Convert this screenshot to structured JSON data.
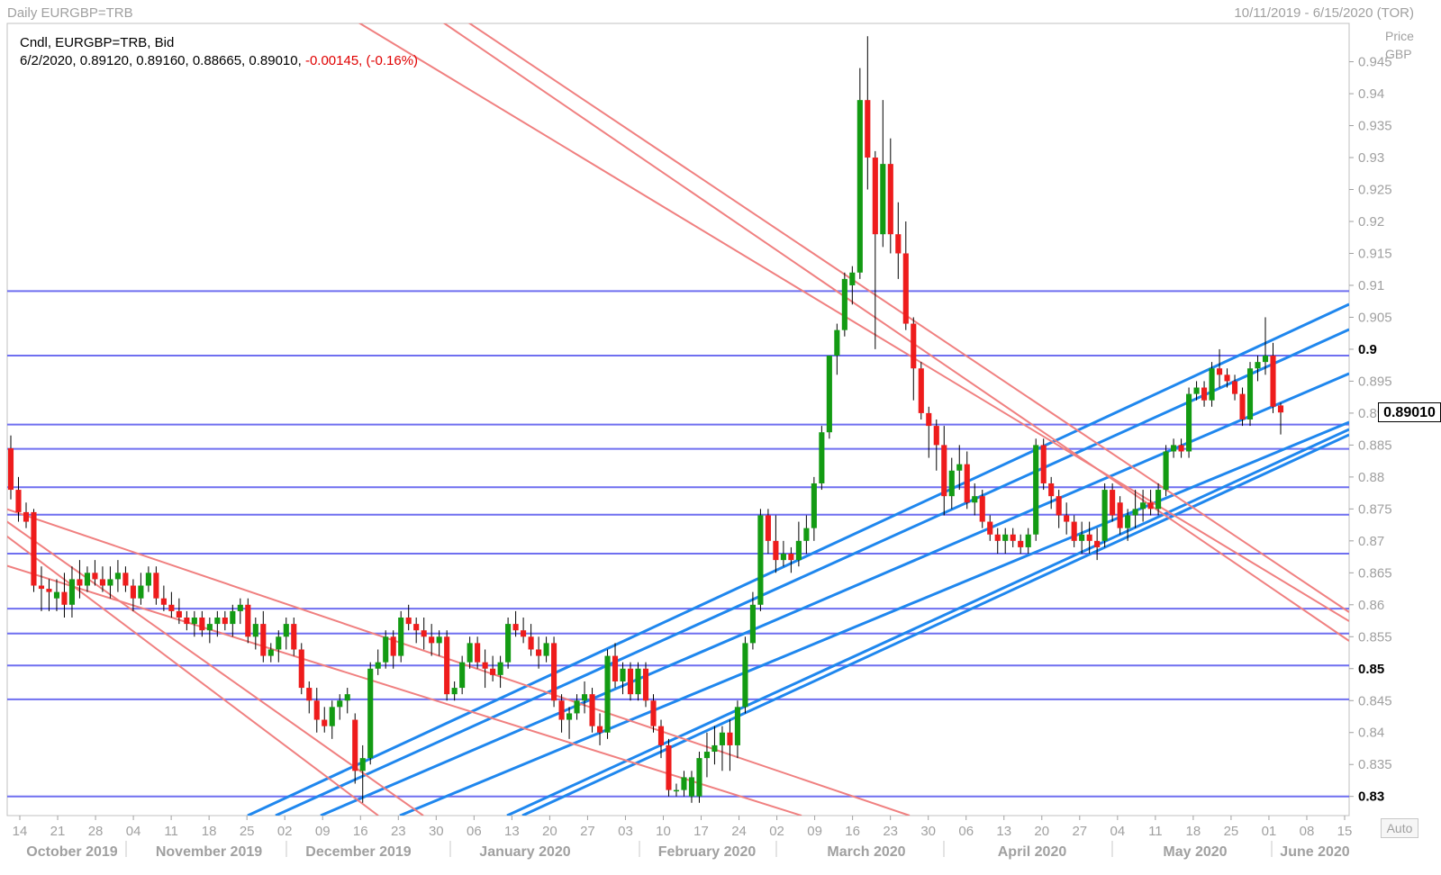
{
  "header": {
    "chart_title": "Daily EURGBP=TRB",
    "date_range": "10/11/2019 - 6/15/2020 (TOR)"
  },
  "legend": {
    "line1": "Cndl, EURGBP=TRB, Bid",
    "values": "6/2/2020, 0.89120, 0.89160, 0.88665, 0.89010,",
    "change": "-0.00145, (-0.16%)"
  },
  "price_axis": {
    "title_line1": "Price",
    "title_line2": "GBP",
    "auto_label": "Auto",
    "last_price": "0.89010"
  },
  "colors": {
    "up_candle": "#139b13",
    "down_candle": "#ee1c1c",
    "horizontal_line": "#6f6ff0",
    "channel_up": "#1f87ee",
    "channel_down": "#f08080",
    "grid_tick": "#a0a0a0"
  },
  "chart_data": {
    "type": "candlestick",
    "ylim": [
      0.827,
      0.951
    ],
    "y_ticks": [
      0.83,
      0.835,
      0.84,
      0.845,
      0.85,
      0.855,
      0.86,
      0.865,
      0.87,
      0.875,
      0.88,
      0.885,
      0.89,
      0.895,
      0.9,
      0.905,
      0.91,
      0.915,
      0.92,
      0.925,
      0.93,
      0.935,
      0.94,
      0.945
    ],
    "y_tick_labels": [
      "0.83",
      "0.835",
      "0.84",
      "0.845",
      "0.85",
      "0.855",
      "0.86",
      "0.865",
      "0.87",
      "0.875",
      "0.88",
      "0.885",
      "0.89",
      "0.895",
      "0.9",
      "0.905",
      "0.91",
      "0.915",
      "0.92",
      "0.925",
      "0.93",
      "0.935",
      "0.94",
      "0.945"
    ],
    "y_tick_bold": [
      "0.83",
      "0.85",
      "0.9"
    ],
    "x_day_labels": [
      "14",
      "21",
      "28",
      "04",
      "11",
      "18",
      "25",
      "02",
      "09",
      "16",
      "23",
      "30",
      "06",
      "13",
      "20",
      "27",
      "03",
      "10",
      "17",
      "24",
      "02",
      "09",
      "16",
      "23",
      "30",
      "06",
      "13",
      "20",
      "27",
      "04",
      "11",
      "18",
      "25",
      "01",
      "08",
      "15"
    ],
    "x_month_labels": [
      "October 2019",
      "November 2019",
      "December 2019",
      "January 2020",
      "February 2020",
      "March 2020",
      "April 2020",
      "May 2020",
      "June 2020"
    ],
    "horizontal_levels": [
      0.9091,
      0.899,
      0.8882,
      0.8844,
      0.8784,
      0.8741,
      0.868,
      0.8594,
      0.8555,
      0.8505,
      0.8452,
      0.83
    ],
    "candles": [
      [
        0.8845,
        0.8865,
        0.8765,
        0.878
      ],
      [
        0.878,
        0.88,
        0.873,
        0.8745
      ],
      [
        0.8745,
        0.876,
        0.872,
        0.873
      ],
      [
        0.8745,
        0.875,
        0.862,
        0.863
      ],
      [
        0.863,
        0.866,
        0.859,
        0.8625
      ],
      [
        0.8625,
        0.864,
        0.859,
        0.862
      ],
      [
        0.861,
        0.864,
        0.859,
        0.862
      ],
      [
        0.862,
        0.865,
        0.858,
        0.86
      ],
      [
        0.86,
        0.866,
        0.858,
        0.864
      ],
      [
        0.864,
        0.867,
        0.861,
        0.863
      ],
      [
        0.863,
        0.866,
        0.862,
        0.865
      ],
      [
        0.865,
        0.867,
        0.863,
        0.864
      ],
      [
        0.864,
        0.866,
        0.862,
        0.863
      ],
      [
        0.863,
        0.866,
        0.861,
        0.864
      ],
      [
        0.864,
        0.867,
        0.862,
        0.865
      ],
      [
        0.865,
        0.866,
        0.862,
        0.863
      ],
      [
        0.863,
        0.864,
        0.859,
        0.861
      ],
      [
        0.861,
        0.865,
        0.86,
        0.863
      ],
      [
        0.863,
        0.866,
        0.862,
        0.865
      ],
      [
        0.865,
        0.866,
        0.86,
        0.861
      ],
      [
        0.861,
        0.863,
        0.859,
        0.86
      ],
      [
        0.86,
        0.862,
        0.858,
        0.859
      ],
      [
        0.859,
        0.861,
        0.857,
        0.858
      ],
      [
        0.858,
        0.859,
        0.856,
        0.857
      ],
      [
        0.857,
        0.859,
        0.855,
        0.858
      ],
      [
        0.858,
        0.859,
        0.855,
        0.856
      ],
      [
        0.856,
        0.858,
        0.854,
        0.857
      ],
      [
        0.857,
        0.859,
        0.855,
        0.858
      ],
      [
        0.858,
        0.859,
        0.856,
        0.857
      ],
      [
        0.857,
        0.86,
        0.855,
        0.859
      ],
      [
        0.859,
        0.861,
        0.857,
        0.86
      ],
      [
        0.86,
        0.861,
        0.854,
        0.855
      ],
      [
        0.855,
        0.858,
        0.853,
        0.857
      ],
      [
        0.857,
        0.859,
        0.851,
        0.852
      ],
      [
        0.852,
        0.854,
        0.851,
        0.853
      ],
      [
        0.853,
        0.856,
        0.851,
        0.855
      ],
      [
        0.855,
        0.858,
        0.853,
        0.857
      ],
      [
        0.857,
        0.858,
        0.852,
        0.853
      ],
      [
        0.853,
        0.854,
        0.846,
        0.847
      ],
      [
        0.847,
        0.848,
        0.843,
        0.845
      ],
      [
        0.845,
        0.847,
        0.84,
        0.842
      ],
      [
        0.842,
        0.844,
        0.84,
        0.841
      ],
      [
        0.841,
        0.845,
        0.839,
        0.844
      ],
      [
        0.844,
        0.846,
        0.842,
        0.845
      ],
      [
        0.845,
        0.847,
        0.843,
        0.846
      ],
      [
        0.842,
        0.843,
        0.832,
        0.834
      ],
      [
        0.834,
        0.838,
        0.829,
        0.836
      ],
      [
        0.836,
        0.851,
        0.835,
        0.85
      ],
      [
        0.85,
        0.853,
        0.849,
        0.851
      ],
      [
        0.851,
        0.856,
        0.85,
        0.855
      ],
      [
        0.855,
        0.856,
        0.85,
        0.852
      ],
      [
        0.852,
        0.859,
        0.851,
        0.858
      ],
      [
        0.858,
        0.86,
        0.856,
        0.857
      ],
      [
        0.857,
        0.858,
        0.854,
        0.856
      ],
      [
        0.856,
        0.858,
        0.853,
        0.855
      ],
      [
        0.855,
        0.857,
        0.852,
        0.854
      ],
      [
        0.854,
        0.856,
        0.852,
        0.855
      ],
      [
        0.855,
        0.856,
        0.845,
        0.846
      ],
      [
        0.846,
        0.848,
        0.845,
        0.847
      ],
      [
        0.847,
        0.852,
        0.846,
        0.851
      ],
      [
        0.851,
        0.855,
        0.85,
        0.854
      ],
      [
        0.854,
        0.855,
        0.85,
        0.851
      ],
      [
        0.851,
        0.853,
        0.847,
        0.85
      ],
      [
        0.85,
        0.852,
        0.848,
        0.849
      ],
      [
        0.849,
        0.852,
        0.847,
        0.851
      ],
      [
        0.851,
        0.858,
        0.85,
        0.857
      ],
      [
        0.857,
        0.859,
        0.855,
        0.856
      ],
      [
        0.856,
        0.858,
        0.854,
        0.855
      ],
      [
        0.855,
        0.857,
        0.852,
        0.853
      ],
      [
        0.853,
        0.855,
        0.85,
        0.852
      ],
      [
        0.852,
        0.855,
        0.851,
        0.854
      ],
      [
        0.854,
        0.855,
        0.844,
        0.845
      ],
      [
        0.845,
        0.846,
        0.84,
        0.842
      ],
      [
        0.842,
        0.844,
        0.839,
        0.843
      ],
      [
        0.843,
        0.846,
        0.842,
        0.845
      ],
      [
        0.845,
        0.848,
        0.843,
        0.846
      ],
      [
        0.846,
        0.847,
        0.84,
        0.841
      ],
      [
        0.841,
        0.843,
        0.838,
        0.84
      ],
      [
        0.84,
        0.853,
        0.839,
        0.852
      ],
      [
        0.852,
        0.854,
        0.847,
        0.848
      ],
      [
        0.848,
        0.851,
        0.846,
        0.85
      ],
      [
        0.85,
        0.851,
        0.845,
        0.846
      ],
      [
        0.846,
        0.851,
        0.845,
        0.85
      ],
      [
        0.85,
        0.851,
        0.844,
        0.845
      ],
      [
        0.845,
        0.846,
        0.84,
        0.841
      ],
      [
        0.841,
        0.842,
        0.836,
        0.838
      ],
      [
        0.838,
        0.839,
        0.83,
        0.831
      ],
      [
        0.831,
        0.832,
        0.83,
        0.831
      ],
      [
        0.831,
        0.834,
        0.83,
        0.833
      ],
      [
        0.83,
        0.834,
        0.829,
        0.833
      ],
      [
        0.83,
        0.837,
        0.829,
        0.836
      ],
      [
        0.836,
        0.84,
        0.833,
        0.837
      ],
      [
        0.837,
        0.841,
        0.835,
        0.838
      ],
      [
        0.838,
        0.841,
        0.834,
        0.84
      ],
      [
        0.84,
        0.842,
        0.834,
        0.838
      ],
      [
        0.838,
        0.845,
        0.836,
        0.844
      ],
      [
        0.844,
        0.855,
        0.843,
        0.854
      ],
      [
        0.854,
        0.862,
        0.853,
        0.86
      ],
      [
        0.86,
        0.875,
        0.859,
        0.874
      ],
      [
        0.874,
        0.875,
        0.868,
        0.87
      ],
      [
        0.87,
        0.874,
        0.865,
        0.867
      ],
      [
        0.867,
        0.87,
        0.866,
        0.868
      ],
      [
        0.868,
        0.869,
        0.865,
        0.867
      ],
      [
        0.867,
        0.873,
        0.866,
        0.87
      ],
      [
        0.87,
        0.874,
        0.868,
        0.872
      ],
      [
        0.872,
        0.88,
        0.87,
        0.879
      ],
      [
        0.879,
        0.888,
        0.878,
        0.887
      ],
      [
        0.887,
        0.899,
        0.886,
        0.899
      ],
      [
        0.899,
        0.904,
        0.896,
        0.903
      ],
      [
        0.903,
        0.912,
        0.902,
        0.911
      ],
      [
        0.91,
        0.913,
        0.907,
        0.912
      ],
      [
        0.912,
        0.944,
        0.911,
        0.939
      ],
      [
        0.939,
        0.949,
        0.925,
        0.93
      ],
      [
        0.93,
        0.931,
        0.9,
        0.918
      ],
      [
        0.918,
        0.939,
        0.916,
        0.929
      ],
      [
        0.929,
        0.933,
        0.915,
        0.918
      ],
      [
        0.918,
        0.923,
        0.911,
        0.915
      ],
      [
        0.915,
        0.92,
        0.903,
        0.904
      ],
      [
        0.904,
        0.905,
        0.892,
        0.897
      ],
      [
        0.897,
        0.898,
        0.889,
        0.89
      ],
      [
        0.89,
        0.891,
        0.883,
        0.888
      ],
      [
        0.888,
        0.889,
        0.881,
        0.885
      ],
      [
        0.885,
        0.888,
        0.874,
        0.877
      ],
      [
        0.877,
        0.883,
        0.875,
        0.881
      ],
      [
        0.881,
        0.885,
        0.878,
        0.882
      ],
      [
        0.882,
        0.884,
        0.875,
        0.876
      ],
      [
        0.876,
        0.879,
        0.874,
        0.877
      ],
      [
        0.877,
        0.878,
        0.872,
        0.873
      ],
      [
        0.873,
        0.874,
        0.87,
        0.871
      ],
      [
        0.871,
        0.872,
        0.868,
        0.87
      ],
      [
        0.87,
        0.872,
        0.868,
        0.871
      ],
      [
        0.871,
        0.872,
        0.869,
        0.87
      ],
      [
        0.87,
        0.871,
        0.868,
        0.869
      ],
      [
        0.869,
        0.872,
        0.868,
        0.871
      ],
      [
        0.871,
        0.886,
        0.87,
        0.885
      ],
      [
        0.885,
        0.886,
        0.878,
        0.879
      ],
      [
        0.879,
        0.88,
        0.875,
        0.877
      ],
      [
        0.877,
        0.878,
        0.872,
        0.874
      ],
      [
        0.874,
        0.876,
        0.871,
        0.873
      ],
      [
        0.873,
        0.874,
        0.869,
        0.87
      ],
      [
        0.87,
        0.873,
        0.868,
        0.871
      ],
      [
        0.871,
        0.873,
        0.868,
        0.87
      ],
      [
        0.87,
        0.872,
        0.867,
        0.869
      ],
      [
        0.87,
        0.879,
        0.869,
        0.878
      ],
      [
        0.878,
        0.879,
        0.873,
        0.874
      ],
      [
        0.876,
        0.877,
        0.871,
        0.872
      ],
      [
        0.872,
        0.875,
        0.87,
        0.874
      ],
      [
        0.874,
        0.878,
        0.872,
        0.875
      ],
      [
        0.875,
        0.878,
        0.873,
        0.876
      ],
      [
        0.876,
        0.878,
        0.874,
        0.875
      ],
      [
        0.875,
        0.879,
        0.874,
        0.878
      ],
      [
        0.878,
        0.885,
        0.877,
        0.884
      ],
      [
        0.884,
        0.886,
        0.883,
        0.885
      ],
      [
        0.885,
        0.886,
        0.883,
        0.884
      ],
      [
        0.884,
        0.894,
        0.883,
        0.893
      ],
      [
        0.893,
        0.895,
        0.892,
        0.894
      ],
      [
        0.894,
        0.895,
        0.891,
        0.892
      ],
      [
        0.892,
        0.898,
        0.891,
        0.897
      ],
      [
        0.897,
        0.9,
        0.894,
        0.896
      ],
      [
        0.896,
        0.897,
        0.894,
        0.895
      ],
      [
        0.895,
        0.896,
        0.892,
        0.893
      ],
      [
        0.893,
        0.894,
        0.888,
        0.889
      ],
      [
        0.889,
        0.898,
        0.888,
        0.897
      ],
      [
        0.897,
        0.899,
        0.895,
        0.898
      ],
      [
        0.898,
        0.905,
        0.896,
        0.899
      ],
      [
        0.899,
        0.901,
        0.89,
        0.891
      ],
      [
        0.8912,
        0.8916,
        0.88665,
        0.8901
      ]
    ],
    "channel_lines_up": [
      [
        [
          275,
          906
        ],
        [
          1498,
          338
        ]
      ],
      [
        [
          306,
          906
        ],
        [
          1498,
          366
        ]
      ],
      [
        [
          356,
          906
        ],
        [
          1498,
          415
        ]
      ],
      [
        [
          444,
          906
        ],
        [
          1498,
          469
        ]
      ],
      [
        [
          563,
          906
        ],
        [
          1498,
          477
        ]
      ],
      [
        [
          580,
          906
        ],
        [
          1498,
          483
        ]
      ]
    ],
    "channel_lines_down": [
      [
        [
          398,
          25
        ],
        [
          1498,
          690
        ]
      ],
      [
        [
          492,
          25
        ],
        [
          1498,
          712
        ]
      ],
      [
        [
          520,
          25
        ],
        [
          1498,
          680
        ]
      ],
      [
        [
          0,
          563
        ],
        [
          1010,
          906
        ]
      ],
      [
        [
          0,
          626
        ],
        [
          890,
          906
        ]
      ],
      [
        [
          0,
          574
        ],
        [
          470,
          906
        ]
      ],
      [
        [
          0,
          590
        ],
        [
          420,
          906
        ]
      ]
    ]
  }
}
